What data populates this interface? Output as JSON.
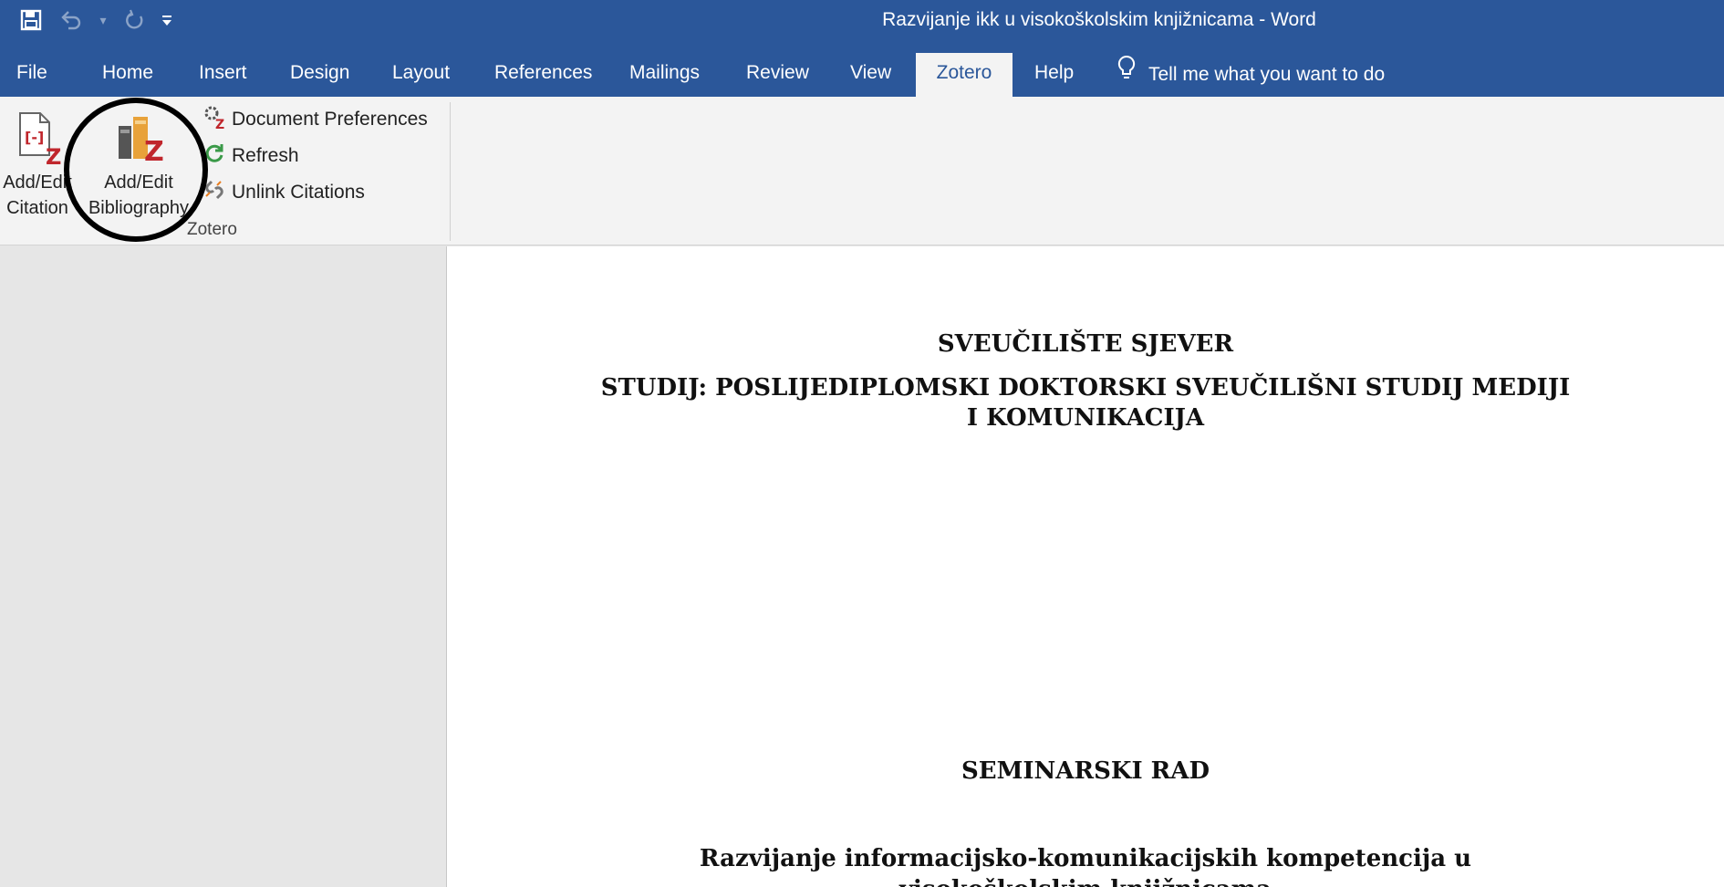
{
  "window": {
    "title": "Razvijanje ikk u visokoškolskim knjižnicama  -  Word"
  },
  "qat": [
    {
      "name": "save-icon",
      "glyph": "🖫"
    },
    {
      "name": "undo-icon",
      "glyph": "↶"
    },
    {
      "name": "redo-icon",
      "glyph": "↻"
    }
  ],
  "tabs": {
    "file": "File",
    "home": "Home",
    "insert": "Insert",
    "design": "Design",
    "layout": "Layout",
    "references": "References",
    "mailings": "Mailings",
    "review": "Review",
    "view": "View",
    "zotero": "Zotero",
    "help": "Help"
  },
  "tell_me": {
    "placeholder": "Tell me what you want to do",
    "icon": "lightbulb-icon"
  },
  "ribbon": {
    "add_edit_citation": {
      "line1": "Add/Edit",
      "line2": "Citation"
    },
    "add_edit_bibliography": {
      "line1": "Add/Edit",
      "line2": "Bibliography"
    },
    "document_preferences": "Document Preferences",
    "refresh": "Refresh",
    "unlink_citations": "Unlink Citations",
    "group_label": "Zotero"
  },
  "document": {
    "university": "SVEUČILIŠTE SJEVER",
    "study_line1": "STUDIJ: POSLIJEDIPLOMSKI DOKTORSKI SVEUČILIŠNI STUDIJ MEDIJI",
    "study_line2": "I KOMUNIKACIJA",
    "paper_type": "SEMINARSKI RAD",
    "title_line1": "Razvijanje informacijsko-komunikacijskih kompetencija u",
    "title_line2": "visokoškolskim knjižnicama"
  },
  "colors": {
    "accent": "#2b579a",
    "zotero_red": "#c0262c"
  }
}
